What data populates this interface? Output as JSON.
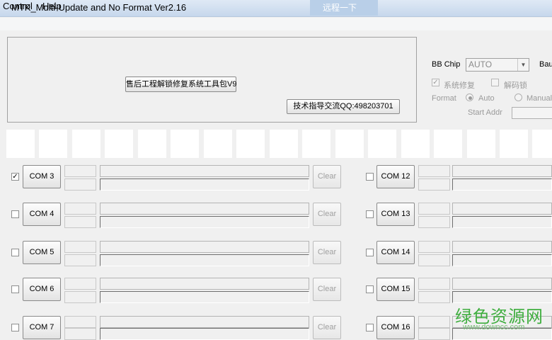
{
  "window": {
    "title": "MTK_Multi-Update and No Format Ver2.16",
    "background_tab": "远程一下"
  },
  "menu": [
    {
      "label": "Control"
    },
    {
      "label": "Help"
    }
  ],
  "top_panel": {
    "tool_button_label": "售后工程解锁修复系统工具包V9",
    "qq_button_label": "技术指导交流QQ:498203701"
  },
  "settings": {
    "bb_chip_label": "BB Chip",
    "bb_chip_value": "AUTO",
    "baud_label": "Bau",
    "system_repair_label": "系统修复",
    "unlock_label": "解码锁",
    "format_label": "Format",
    "auto_label": "Auto",
    "manual_label": "Manual",
    "start_addr_label": "Start Addr"
  },
  "ports_left": [
    {
      "label": "COM 3",
      "checked": "✓"
    },
    {
      "label": "COM 4",
      "checked": ""
    },
    {
      "label": "COM 5",
      "checked": ""
    },
    {
      "label": "COM 6",
      "checked": ""
    },
    {
      "label": "COM 7",
      "checked": ""
    }
  ],
  "ports_right": [
    {
      "label": "COM 12"
    },
    {
      "label": "COM 13"
    },
    {
      "label": "COM 14"
    },
    {
      "label": "COM 15"
    },
    {
      "label": "COM 16"
    }
  ],
  "clear_label": "Clear",
  "watermark": {
    "name": "绿色资源网",
    "url": "www.downcc.com"
  },
  "colors": {
    "title_bar": "#c6d7ec",
    "window_bg": "#f0f0f0",
    "watermark": "#3fae3f"
  }
}
